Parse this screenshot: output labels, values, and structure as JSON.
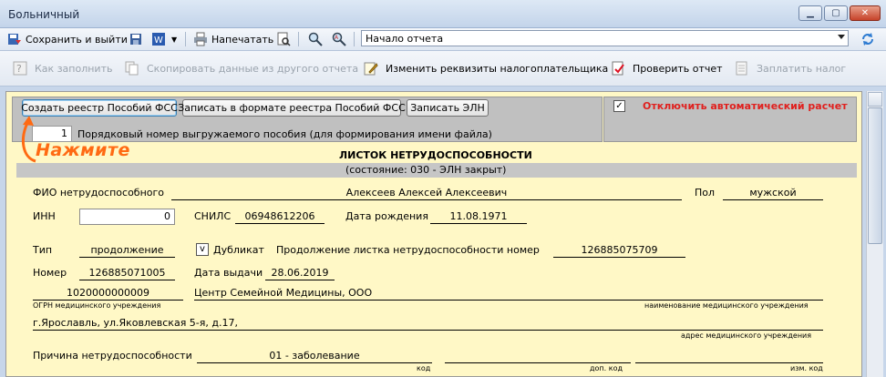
{
  "window": {
    "title": "Больничный"
  },
  "toolbar1": {
    "save_exit": "Сохранить и выйти",
    "print": "Напечатать",
    "combo_value": "Начало отчета"
  },
  "toolbar2": {
    "how_fill": "Как заполнить",
    "copy_data": "Скопировать данные из другого отчета",
    "change_req": "Изменить реквизиты налогоплательщика",
    "check": "Проверить отчет",
    "pay_tax": "Заплатить налог"
  },
  "panel": {
    "btn_create_registry": "Создать реестр Пособий ФСС",
    "btn_write_format": "Записать в формате реестра Пособий ФСС",
    "btn_write_eln": "Записать ЭЛН",
    "seq_number": "1",
    "seq_label": "Порядковый номер выгружаемого пособия (для формирования имени файла)",
    "auto_calc_checked": "✓",
    "auto_calc_label": "Отключить автоматический расчет"
  },
  "annotation": "Нажмите",
  "form": {
    "title": "ЛИСТОК НЕТРУДОСПОСОБНОСТИ",
    "state": "(состояние:  030 - ЭЛН закрыт)",
    "fio_label": "ФИО нетрудоспособного",
    "fio_value": "Алексеев Алексей Алексеевич",
    "sex_label": "Пол",
    "sex_value": "мужской",
    "inn_label": "ИНН",
    "inn_value": "0",
    "snils_label": "СНИЛС",
    "snils_value": "06948612206",
    "birth_label": "Дата рождения",
    "birth_value": "11.08.1971",
    "type_label": "Тип",
    "type_value": "продолжение",
    "dup_checked": "v",
    "dup_label": "Дубликат",
    "cont_label": "Продолжение листка нетрудоспособности номер",
    "cont_value": "126885075709",
    "num_label": "Номер",
    "num_value": "126885071005",
    "issue_label": "Дата выдачи",
    "issue_value": "28.06.2019",
    "ogrn_value": "1020000000009",
    "org_value": "Центр Семейной Медицины, ООО",
    "ogrn_caption": "ОГРН медицинского учреждения",
    "org_caption": "наименование медицинского учреждения",
    "address_value": "г.Ярославль, ул.Яковлевская 5-я, д.17,",
    "address_caption": "адрес медицинского учреждения",
    "reason_label": "Причина нетрудоспособности",
    "reason_value": "01 - заболевание",
    "code_caption": "код",
    "addcode_caption": "доп. код",
    "chgcode_caption": "изм. код"
  }
}
